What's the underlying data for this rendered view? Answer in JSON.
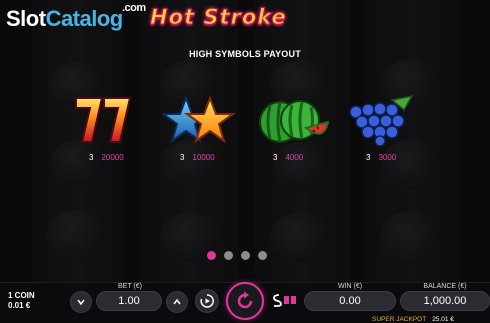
{
  "watermark": {
    "part1": "Slot",
    "part2": "Catalog",
    "suffix": ".com"
  },
  "game": {
    "title": "Hot Stroke"
  },
  "payout": {
    "title": "HIGH SYMBOLS PAYOUT",
    "symbols": [
      {
        "icon": "lucky-seven-icon",
        "count": "3",
        "value": "20000"
      },
      {
        "icon": "star-icon",
        "count": "3",
        "value": "10000"
      },
      {
        "icon": "watermelon-icon",
        "count": "3",
        "value": "4000"
      },
      {
        "icon": "grapes-icon",
        "count": "3",
        "value": "3000"
      }
    ],
    "page": {
      "current": 1,
      "total": 4
    }
  },
  "controls": {
    "coin_line1": "1 COIN",
    "coin_line2": "0.01 €",
    "bet_label": "BET (€)",
    "bet_value": "1.00",
    "win_label": "WIN (€)",
    "win_value": "0.00",
    "balance_label": "BALANCE (€)",
    "balance_value": "1,000.00",
    "super_jackpot_label": "SUPER JACKPOT",
    "super_jackpot_value": "25.01 €"
  },
  "colors": {
    "accent": "#e0389a",
    "jackpot": "#e8b21c",
    "logo": "#ffcf3a",
    "watermark": "#49b4e6"
  }
}
